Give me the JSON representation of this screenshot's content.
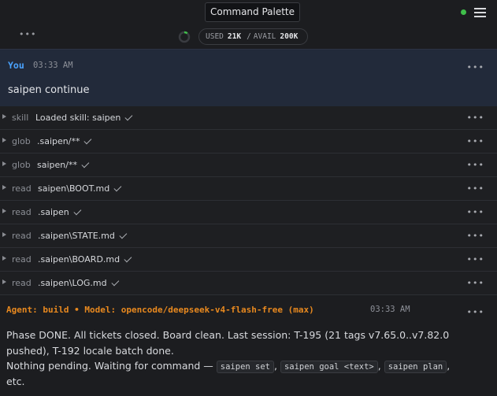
{
  "topbar": {
    "command_palette_label": "Command Palette",
    "more_label": "•••",
    "status_color": "#3fbf4a"
  },
  "usage": {
    "used_label": "USED",
    "used_value": "21K",
    "separator": "/",
    "avail_label": "AVAIL",
    "avail_value": "200K",
    "used_fraction": 0.105
  },
  "user_message": {
    "author": "You",
    "time": "03:33 AM",
    "text": "saipen continue",
    "menu": "•••"
  },
  "tool_rows": [
    {
      "kind": "skill",
      "arg": "Loaded skill: saipen",
      "menu": "•••"
    },
    {
      "kind": "glob",
      "arg": ".saipen/**",
      "menu": "•••"
    },
    {
      "kind": "glob",
      "arg": "saipen/**",
      "menu": "•••"
    },
    {
      "kind": "read",
      "arg": "saipen\\BOOT.md",
      "menu": "•••"
    },
    {
      "kind": "read",
      "arg": ".saipen",
      "menu": "•••"
    },
    {
      "kind": "read",
      "arg": ".saipen\\STATE.md",
      "menu": "•••"
    },
    {
      "kind": "read",
      "arg": ".saipen\\BOARD.md",
      "menu": "•••"
    },
    {
      "kind": "read",
      "arg": ".saipen\\LOG.md",
      "menu": "•••"
    }
  ],
  "agent_message": {
    "header": "Agent: build • Model: opencode/deepseek-v4-flash-free (max)",
    "time": "03:33 AM",
    "menu": "•••",
    "line1": "Phase DONE. All tickets closed. Board clean. Last session: T-195 (21 tags v7.65.0..v7.82.0 pushed), T-192 locale batch done.",
    "line2_prefix": "Nothing pending. Waiting for command — ",
    "cmd1": "saipen set",
    "comma1": ", ",
    "cmd2": "saipen goal <text>",
    "comma2": ", ",
    "cmd3": "saipen plan",
    "line2_suffix": ",",
    "line3": "etc."
  },
  "colors": {
    "user_accent": "#4aa3ff",
    "agent_accent": "#e8891f",
    "progress": "#3fbf4a"
  }
}
